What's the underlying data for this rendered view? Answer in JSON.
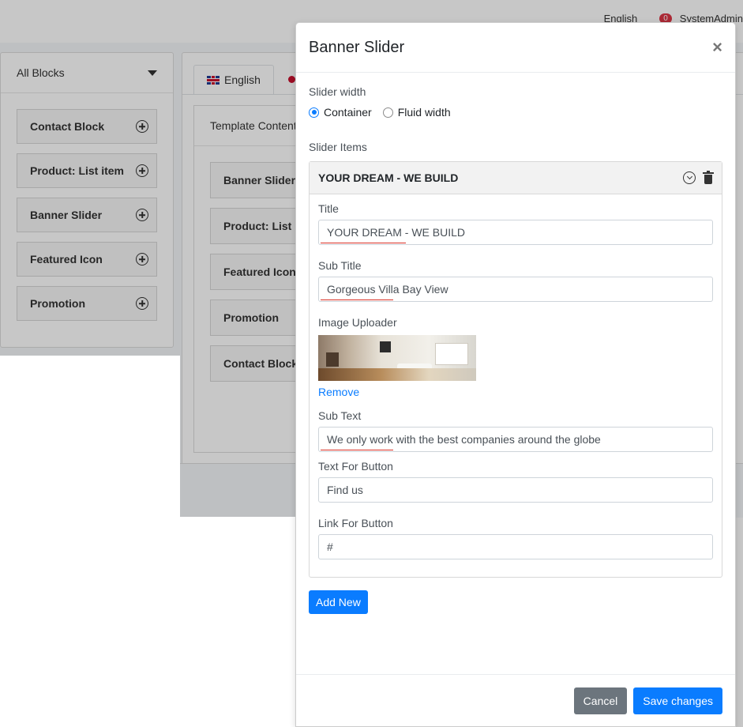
{
  "background": {
    "top_right": {
      "language": "English",
      "badge_count": "0",
      "user": "SystemAdmin"
    },
    "left_panel": {
      "dropdown_label": "All Blocks",
      "items": [
        "Contact Block",
        "Product: List item",
        "Banner Slider",
        "Featured Icon",
        "Promotion"
      ]
    },
    "main_panel": {
      "tabs": [
        "English"
      ],
      "inner_title": "Template Content",
      "items": [
        "Banner Slider",
        "Product: List item",
        "Featured Icon",
        "Promotion",
        "Contact Block"
      ]
    }
  },
  "modal": {
    "title": "Banner Slider",
    "close_symbol": "×",
    "slider_width_label": "Slider width",
    "radio_options": [
      {
        "label": "Container",
        "checked": true
      },
      {
        "label": "Fluid width",
        "checked": false
      }
    ],
    "slider_items_label": "Slider Items",
    "item": {
      "header": "YOUR DREAM - WE BUILD",
      "fields": {
        "title_label": "Title",
        "title_value": "YOUR DREAM - WE BUILD",
        "subtitle_label": "Sub Title",
        "subtitle_value": "Gorgeous Villa Bay View",
        "image_label": "Image Uploader",
        "remove_label": "Remove",
        "subtext_label": "Sub Text",
        "subtext_value": "We only work with the best companies around the globe",
        "button_text_label": "Text For Button",
        "button_text_value": "Find us",
        "link_label": "Link For Button",
        "link_value": "#"
      }
    },
    "add_new_label": "Add New",
    "cancel_label": "Cancel",
    "save_label": "Save changes"
  },
  "colors": {
    "primary": "#0a7cff",
    "secondary": "#6c757d",
    "spell_underline": "#d93025"
  }
}
